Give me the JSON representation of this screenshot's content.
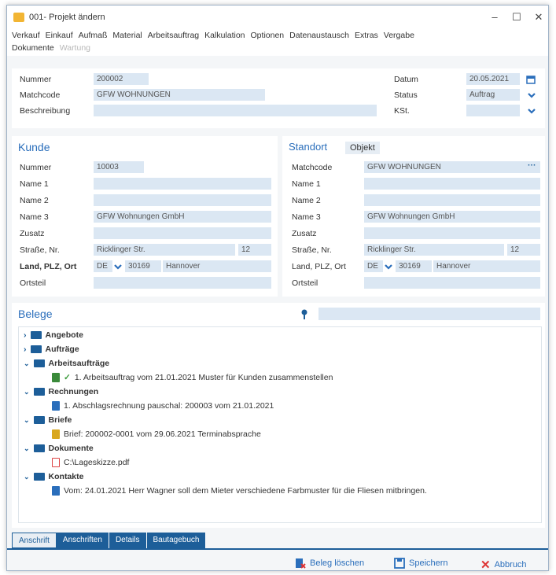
{
  "window": {
    "title": "001- Projekt ändern"
  },
  "menu": {
    "row1": [
      "Verkauf",
      "Einkauf",
      "Aufmaß",
      "Material",
      "Arbeitsauftrag",
      "Kalkulation",
      "Optionen",
      "Datenaustausch",
      "Extras",
      "Vergabe"
    ],
    "row2": [
      "Dokumente",
      "Wartung"
    ]
  },
  "project": {
    "nummer_label": "Nummer",
    "nummer": "200002",
    "matchcode_label": "Matchcode",
    "matchcode": "GFW WOHNUNGEN",
    "beschreibung_label": "Beschreibung",
    "beschreibung": "",
    "datum_label": "Datum",
    "datum": "20.05.2021",
    "status_label": "Status",
    "status": "Auftrag",
    "kst_label": "KSt.",
    "kst": ""
  },
  "kunde": {
    "title": "Kunde",
    "nummer_label": "Nummer",
    "nummer": "10003",
    "name1_label": "Name 1",
    "name1": "",
    "name2_label": "Name 2",
    "name2": "",
    "name3_label": "Name 3",
    "name3": "GFW Wohnungen GmbH",
    "zusatz_label": "Zusatz",
    "zusatz": "",
    "strasse_label": "Straße, Nr.",
    "strasse": "Ricklinger Str.",
    "hausnr": "12",
    "land_label": "Land, PLZ, Ort",
    "land": "DE",
    "plz": "30169",
    "ort": "Hannover",
    "ortsteil_label": "Ortsteil",
    "ortsteil": ""
  },
  "standort": {
    "tab_standort": "Standort",
    "tab_objekt": "Objekt",
    "matchcode_label": "Matchcode",
    "matchcode": "GFW WOHNUNGEN",
    "name1_label": "Name 1",
    "name1": "",
    "name2_label": "Name 2",
    "name2": "",
    "name3_label": "Name 3",
    "name3": "GFW Wohnungen GmbH",
    "zusatz_label": "Zusatz",
    "zusatz": "",
    "strasse_label": "Straße, Nr.",
    "strasse": "Ricklinger Str.",
    "hausnr": "12",
    "land_label": "Land, PLZ, Ort",
    "land": "DE",
    "plz": "30169",
    "ort": "Hannover",
    "ortsteil_label": "Ortsteil",
    "ortsteil": ""
  },
  "belege": {
    "title": "Belege",
    "tree": [
      {
        "label": "Angebote"
      },
      {
        "label": "Aufträge"
      },
      {
        "label": "Arbeitsaufträge",
        "child": "1. Arbeitsauftrag vom 21.01.2021 Muster für Kunden zusammenstellen"
      },
      {
        "label": "Rechnungen",
        "child": "1. Abschlagsrechnung pauschal: 200003 vom 21.01.2021"
      },
      {
        "label": "Briefe",
        "child": "Brief: 200002-0001 vom 29.06.2021 Terminabsprache"
      },
      {
        "label": "Dokumente",
        "child": "C:\\Lageskizze.pdf"
      },
      {
        "label": "Kontakte",
        "child": "Vom: 24.01.2021  Herr Wagner soll dem Mieter verschiedene Farbmuster für die Fliesen mitbringen."
      }
    ]
  },
  "bottom_tabs": [
    "Anschrift",
    "Anschriften",
    "Details",
    "Bautagebuch"
  ],
  "footer": {
    "delete": "Beleg löschen",
    "save": "Speichern",
    "cancel": "Abbruch"
  },
  "colors": {
    "accent": "#2a6ebb",
    "field": "#dbe7f3",
    "nav": "#1d5e99"
  }
}
